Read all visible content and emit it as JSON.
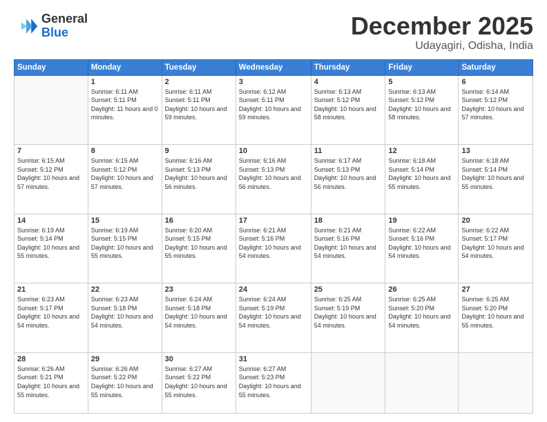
{
  "logo": {
    "line1": "General",
    "line2": "Blue"
  },
  "title": "December 2025",
  "subtitle": "Udayagiri, Odisha, India",
  "days_of_week": [
    "Sunday",
    "Monday",
    "Tuesday",
    "Wednesday",
    "Thursday",
    "Friday",
    "Saturday"
  ],
  "weeks": [
    [
      {
        "day": "",
        "empty": true
      },
      {
        "day": "1",
        "sunrise": "6:11 AM",
        "sunset": "5:11 PM",
        "daylight": "11 hours and 0 minutes."
      },
      {
        "day": "2",
        "sunrise": "6:11 AM",
        "sunset": "5:11 PM",
        "daylight": "10 hours and 59 minutes."
      },
      {
        "day": "3",
        "sunrise": "6:12 AM",
        "sunset": "5:11 PM",
        "daylight": "10 hours and 59 minutes."
      },
      {
        "day": "4",
        "sunrise": "6:13 AM",
        "sunset": "5:12 PM",
        "daylight": "10 hours and 58 minutes."
      },
      {
        "day": "5",
        "sunrise": "6:13 AM",
        "sunset": "5:12 PM",
        "daylight": "10 hours and 58 minutes."
      },
      {
        "day": "6",
        "sunrise": "6:14 AM",
        "sunset": "5:12 PM",
        "daylight": "10 hours and 57 minutes."
      }
    ],
    [
      {
        "day": "7",
        "sunrise": "6:15 AM",
        "sunset": "5:12 PM",
        "daylight": "10 hours and 57 minutes."
      },
      {
        "day": "8",
        "sunrise": "6:15 AM",
        "sunset": "5:12 PM",
        "daylight": "10 hours and 57 minutes."
      },
      {
        "day": "9",
        "sunrise": "6:16 AM",
        "sunset": "5:13 PM",
        "daylight": "10 hours and 56 minutes."
      },
      {
        "day": "10",
        "sunrise": "6:16 AM",
        "sunset": "5:13 PM",
        "daylight": "10 hours and 56 minutes."
      },
      {
        "day": "11",
        "sunrise": "6:17 AM",
        "sunset": "5:13 PM",
        "daylight": "10 hours and 56 minutes."
      },
      {
        "day": "12",
        "sunrise": "6:18 AM",
        "sunset": "5:14 PM",
        "daylight": "10 hours and 55 minutes."
      },
      {
        "day": "13",
        "sunrise": "6:18 AM",
        "sunset": "5:14 PM",
        "daylight": "10 hours and 55 minutes."
      }
    ],
    [
      {
        "day": "14",
        "sunrise": "6:19 AM",
        "sunset": "5:14 PM",
        "daylight": "10 hours and 55 minutes."
      },
      {
        "day": "15",
        "sunrise": "6:19 AM",
        "sunset": "5:15 PM",
        "daylight": "10 hours and 55 minutes."
      },
      {
        "day": "16",
        "sunrise": "6:20 AM",
        "sunset": "5:15 PM",
        "daylight": "10 hours and 55 minutes."
      },
      {
        "day": "17",
        "sunrise": "6:21 AM",
        "sunset": "5:16 PM",
        "daylight": "10 hours and 54 minutes."
      },
      {
        "day": "18",
        "sunrise": "6:21 AM",
        "sunset": "5:16 PM",
        "daylight": "10 hours and 54 minutes."
      },
      {
        "day": "19",
        "sunrise": "6:22 AM",
        "sunset": "5:16 PM",
        "daylight": "10 hours and 54 minutes."
      },
      {
        "day": "20",
        "sunrise": "6:22 AM",
        "sunset": "5:17 PM",
        "daylight": "10 hours and 54 minutes."
      }
    ],
    [
      {
        "day": "21",
        "sunrise": "6:23 AM",
        "sunset": "5:17 PM",
        "daylight": "10 hours and 54 minutes."
      },
      {
        "day": "22",
        "sunrise": "6:23 AM",
        "sunset": "5:18 PM",
        "daylight": "10 hours and 54 minutes."
      },
      {
        "day": "23",
        "sunrise": "6:24 AM",
        "sunset": "5:18 PM",
        "daylight": "10 hours and 54 minutes."
      },
      {
        "day": "24",
        "sunrise": "6:24 AM",
        "sunset": "5:19 PM",
        "daylight": "10 hours and 54 minutes."
      },
      {
        "day": "25",
        "sunrise": "6:25 AM",
        "sunset": "5:19 PM",
        "daylight": "10 hours and 54 minutes."
      },
      {
        "day": "26",
        "sunrise": "6:25 AM",
        "sunset": "5:20 PM",
        "daylight": "10 hours and 54 minutes."
      },
      {
        "day": "27",
        "sunrise": "6:25 AM",
        "sunset": "5:20 PM",
        "daylight": "10 hours and 55 minutes."
      }
    ],
    [
      {
        "day": "28",
        "sunrise": "6:26 AM",
        "sunset": "5:21 PM",
        "daylight": "10 hours and 55 minutes."
      },
      {
        "day": "29",
        "sunrise": "6:26 AM",
        "sunset": "5:22 PM",
        "daylight": "10 hours and 55 minutes."
      },
      {
        "day": "30",
        "sunrise": "6:27 AM",
        "sunset": "5:22 PM",
        "daylight": "10 hours and 55 minutes."
      },
      {
        "day": "31",
        "sunrise": "6:27 AM",
        "sunset": "5:23 PM",
        "daylight": "10 hours and 55 minutes."
      },
      {
        "day": "",
        "empty": true
      },
      {
        "day": "",
        "empty": true
      },
      {
        "day": "",
        "empty": true
      }
    ]
  ]
}
